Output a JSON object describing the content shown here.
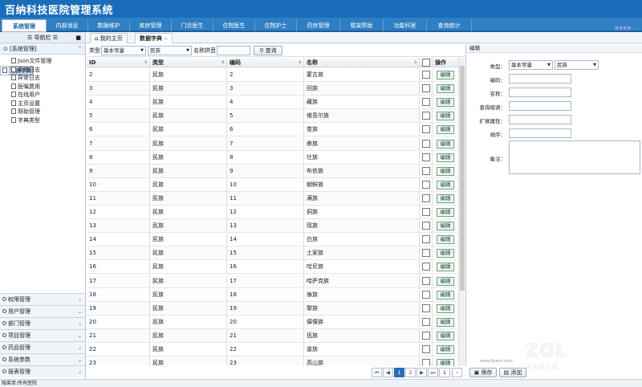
{
  "app": {
    "title": "百纳科技医院管理系统",
    "user_info": "技术支持：…"
  },
  "nav": [
    "系统管理",
    "内部消息",
    "数据维护",
    "库房管理",
    "门诊医生",
    "住院医生",
    "住院护士",
    "药房管理",
    "框架帮助",
    "功能科室",
    "查询统计"
  ],
  "sidebar": {
    "header": "☰ 导航栏 ☰",
    "group": "[系统管理]",
    "items": [
      "Json文件管理",
      "数据字典",
      "系统日志",
      "异常日志",
      "医嘱费用",
      "在线用户",
      "主页设置",
      "帮助管理",
      "字典类型"
    ],
    "groups": [
      "权限管理",
      "用户管理",
      "部门管理",
      "项目管理",
      "药品管理",
      "系统参数",
      "报表管理"
    ]
  },
  "tabs": [
    "我的主页",
    "数据字典"
  ],
  "toolbar": {
    "type_label": "类型",
    "type_value": "基本常量",
    "sub_value": "民族",
    "name_label": "名称拼音",
    "query": "查询"
  },
  "grid": {
    "columns": [
      "ID",
      "类型",
      "编码",
      "名称",
      "",
      "操作"
    ],
    "edit_label": "编辑",
    "rows": [
      [
        "2",
        "民族",
        "2",
        "蒙古族"
      ],
      [
        "3",
        "民族",
        "3",
        "回族"
      ],
      [
        "4",
        "民族",
        "4",
        "藏族"
      ],
      [
        "5",
        "民族",
        "5",
        "维吾尔族"
      ],
      [
        "6",
        "民族",
        "6",
        "苗族"
      ],
      [
        "7",
        "民族",
        "7",
        "彝族"
      ],
      [
        "8",
        "民族",
        "8",
        "壮族"
      ],
      [
        "9",
        "民族",
        "9",
        "布依族"
      ],
      [
        "10",
        "民族",
        "10",
        "朝鲜族"
      ],
      [
        "11",
        "民族",
        "11",
        "满族"
      ],
      [
        "12",
        "民族",
        "12",
        "侗族"
      ],
      [
        "13",
        "民族",
        "13",
        "瑶族"
      ],
      [
        "14",
        "民族",
        "14",
        "白族"
      ],
      [
        "15",
        "民族",
        "15",
        "土家族"
      ],
      [
        "16",
        "民族",
        "16",
        "哈尼族"
      ],
      [
        "17",
        "民族",
        "17",
        "哈萨克族"
      ],
      [
        "18",
        "民族",
        "18",
        "傣族"
      ],
      [
        "19",
        "民族",
        "19",
        "黎族"
      ],
      [
        "20",
        "民族",
        "20",
        "傈僳族"
      ],
      [
        "21",
        "民族",
        "21",
        "佤族"
      ],
      [
        "22",
        "民族",
        "22",
        "畲族"
      ],
      [
        "23",
        "民族",
        "23",
        "高山族"
      ]
    ]
  },
  "pager": {
    "first": "⏮",
    "prev": "◀",
    "p1": "1",
    "p2": "2",
    "next": "▶",
    "last": "⏭",
    "goto": "1",
    "go": "›"
  },
  "edit": {
    "title": "编辑",
    "type_label": "类型：",
    "type_value": "基本常量",
    "sub_value": "民族",
    "fields": [
      "编码：",
      "名称：",
      "查询缩语：",
      "扩展属性：",
      "顺序："
    ],
    "remark": "备注：",
    "save": "保存",
    "add": "添加"
  },
  "status": "隐菜单:所有医院",
  "watermark": {
    "brand": "ZOL",
    "cn": "中关村在线",
    "url": "www.9ywm.com"
  }
}
